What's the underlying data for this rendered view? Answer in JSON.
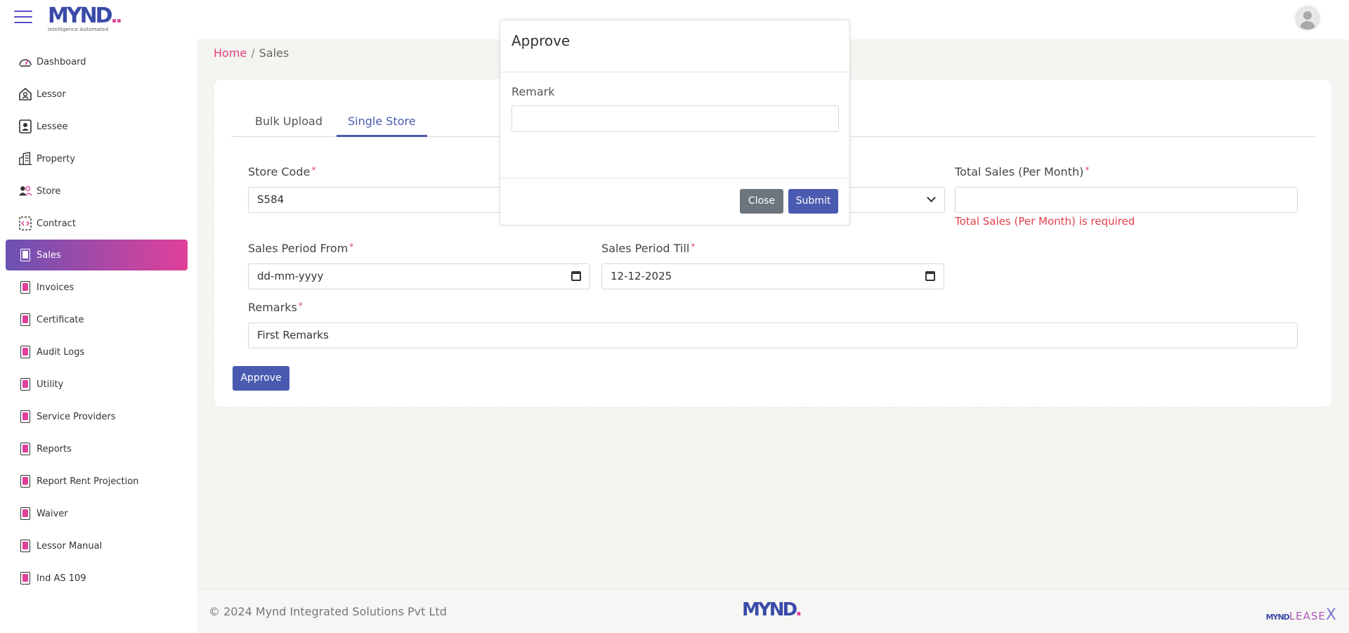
{
  "header": {
    "logo_text": "MYND",
    "logo_tagline": "Intelligence Automated"
  },
  "sidebar": {
    "items": [
      {
        "label": "Dashboard",
        "icon": "dashboard-icon"
      },
      {
        "label": "Lessor",
        "icon": "lessor-icon"
      },
      {
        "label": "Lessee",
        "icon": "lessee-icon"
      },
      {
        "label": "Property",
        "icon": "building-icon"
      },
      {
        "label": "Store",
        "icon": "users-icon"
      },
      {
        "label": "Contract",
        "icon": "contract-icon"
      },
      {
        "label": "Sales",
        "icon": "document-icon",
        "active": true
      },
      {
        "label": "Invoices",
        "icon": "document-icon"
      },
      {
        "label": "Certificate",
        "icon": "document-icon"
      },
      {
        "label": "Audit Logs",
        "icon": "document-icon"
      },
      {
        "label": "Utility",
        "icon": "document-icon"
      },
      {
        "label": "Service Providers",
        "icon": "document-icon"
      },
      {
        "label": "Reports",
        "icon": "document-icon"
      },
      {
        "label": "Report Rent Projection",
        "icon": "document-icon"
      },
      {
        "label": "Waiver",
        "icon": "document-icon"
      },
      {
        "label": "Lessor Manual",
        "icon": "document-icon"
      },
      {
        "label": "Ind AS 109",
        "icon": "document-icon"
      }
    ]
  },
  "breadcrumb": {
    "home": "Home",
    "separator": "/",
    "current": "Sales"
  },
  "tabs": [
    {
      "label": "Bulk Upload"
    },
    {
      "label": "Single Store",
      "active": true
    }
  ],
  "form": {
    "store_code_label": "Store Code",
    "store_code_value": "S584",
    "total_sales_label": "Total Sales (Per Month)",
    "total_sales_value": "",
    "total_sales_error": "Total Sales (Per Month) is required",
    "period_from_label": "Sales Period From",
    "period_from_value": "dd-mm-yyyy",
    "period_till_label": "Sales Period Till",
    "period_till_value": "12-12-2025",
    "remarks_label": "Remarks",
    "remarks_value": "First Remarks",
    "required_marker": "*",
    "approve_button": "Approve"
  },
  "modal": {
    "title": "Approve",
    "remark_label": "Remark",
    "remark_value": "",
    "close_button": "Close",
    "submit_button": "Submit"
  },
  "footer": {
    "copyright": "© 2024 Mynd Integrated Solutions Pvt Ltd",
    "logo_text": "MYND",
    "product_mark_prefix": "MYND",
    "product_mark_word": "LEASE",
    "product_mark_x": "X"
  },
  "colors": {
    "primary": "#4a5ab0",
    "accent": "#e0409a",
    "error": "#e0404a",
    "secondary_button": "#6c757d"
  }
}
